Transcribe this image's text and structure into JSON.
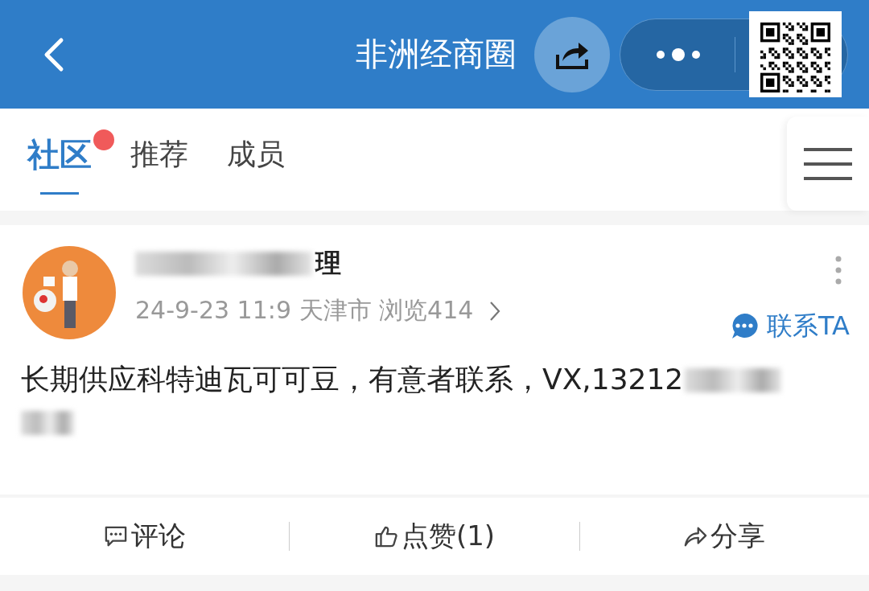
{
  "header": {
    "title": "非洲经商圈"
  },
  "tabs": [
    {
      "label": "社区",
      "selected": true,
      "badge": true
    },
    {
      "label": "推荐",
      "selected": false,
      "badge": false
    },
    {
      "label": "成员",
      "selected": false,
      "badge": false
    }
  ],
  "post": {
    "author": "理",
    "meta": "24-9-23 11:9 天津市 浏览414",
    "contact": "联系TA",
    "body": "长期供应科特迪瓦可可豆，有意者联系，VX,13212"
  },
  "actions": [
    {
      "kind": "comment",
      "label": "评论"
    },
    {
      "kind": "like",
      "label": "点赞(1)"
    },
    {
      "kind": "share",
      "label": "分享"
    }
  ]
}
